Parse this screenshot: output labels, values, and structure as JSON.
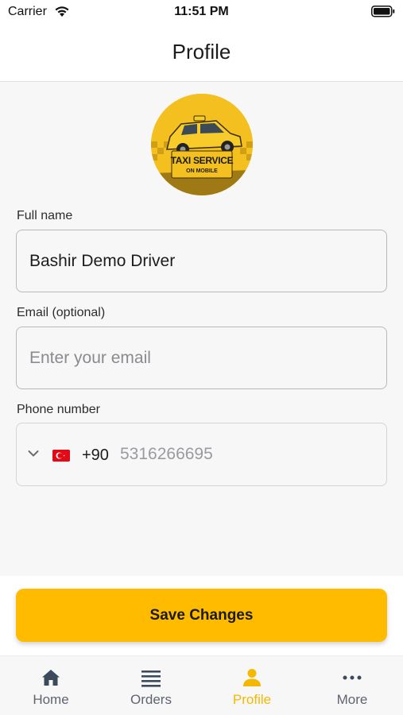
{
  "status_bar": {
    "carrier": "Carrier",
    "time": "11:51 PM"
  },
  "header": {
    "title": "Profile"
  },
  "avatar": {
    "line1": "TAXI SERVICE",
    "line2": "ON MOBILE"
  },
  "form": {
    "full_name": {
      "label": "Full name",
      "value": "Bashir Demo Driver"
    },
    "email": {
      "label": "Email (optional)",
      "placeholder": "Enter your email",
      "value": ""
    },
    "phone": {
      "label": "Phone number",
      "dial_code": "+90",
      "placeholder": "5316266695",
      "country_flag": "turkey-flag-icon"
    }
  },
  "save_button": {
    "label": "Save Changes"
  },
  "colors": {
    "accent": "#ffbb00",
    "active_tab": "#f5b800",
    "inactive_tab": "#5f6470"
  },
  "tab_bar": {
    "active": "profile",
    "tabs": [
      {
        "key": "home",
        "label": "Home",
        "icon": "home-icon"
      },
      {
        "key": "orders",
        "label": "Orders",
        "icon": "list-icon"
      },
      {
        "key": "profile",
        "label": "Profile",
        "icon": "person-icon"
      },
      {
        "key": "more",
        "label": "More",
        "icon": "more-icon"
      }
    ]
  }
}
